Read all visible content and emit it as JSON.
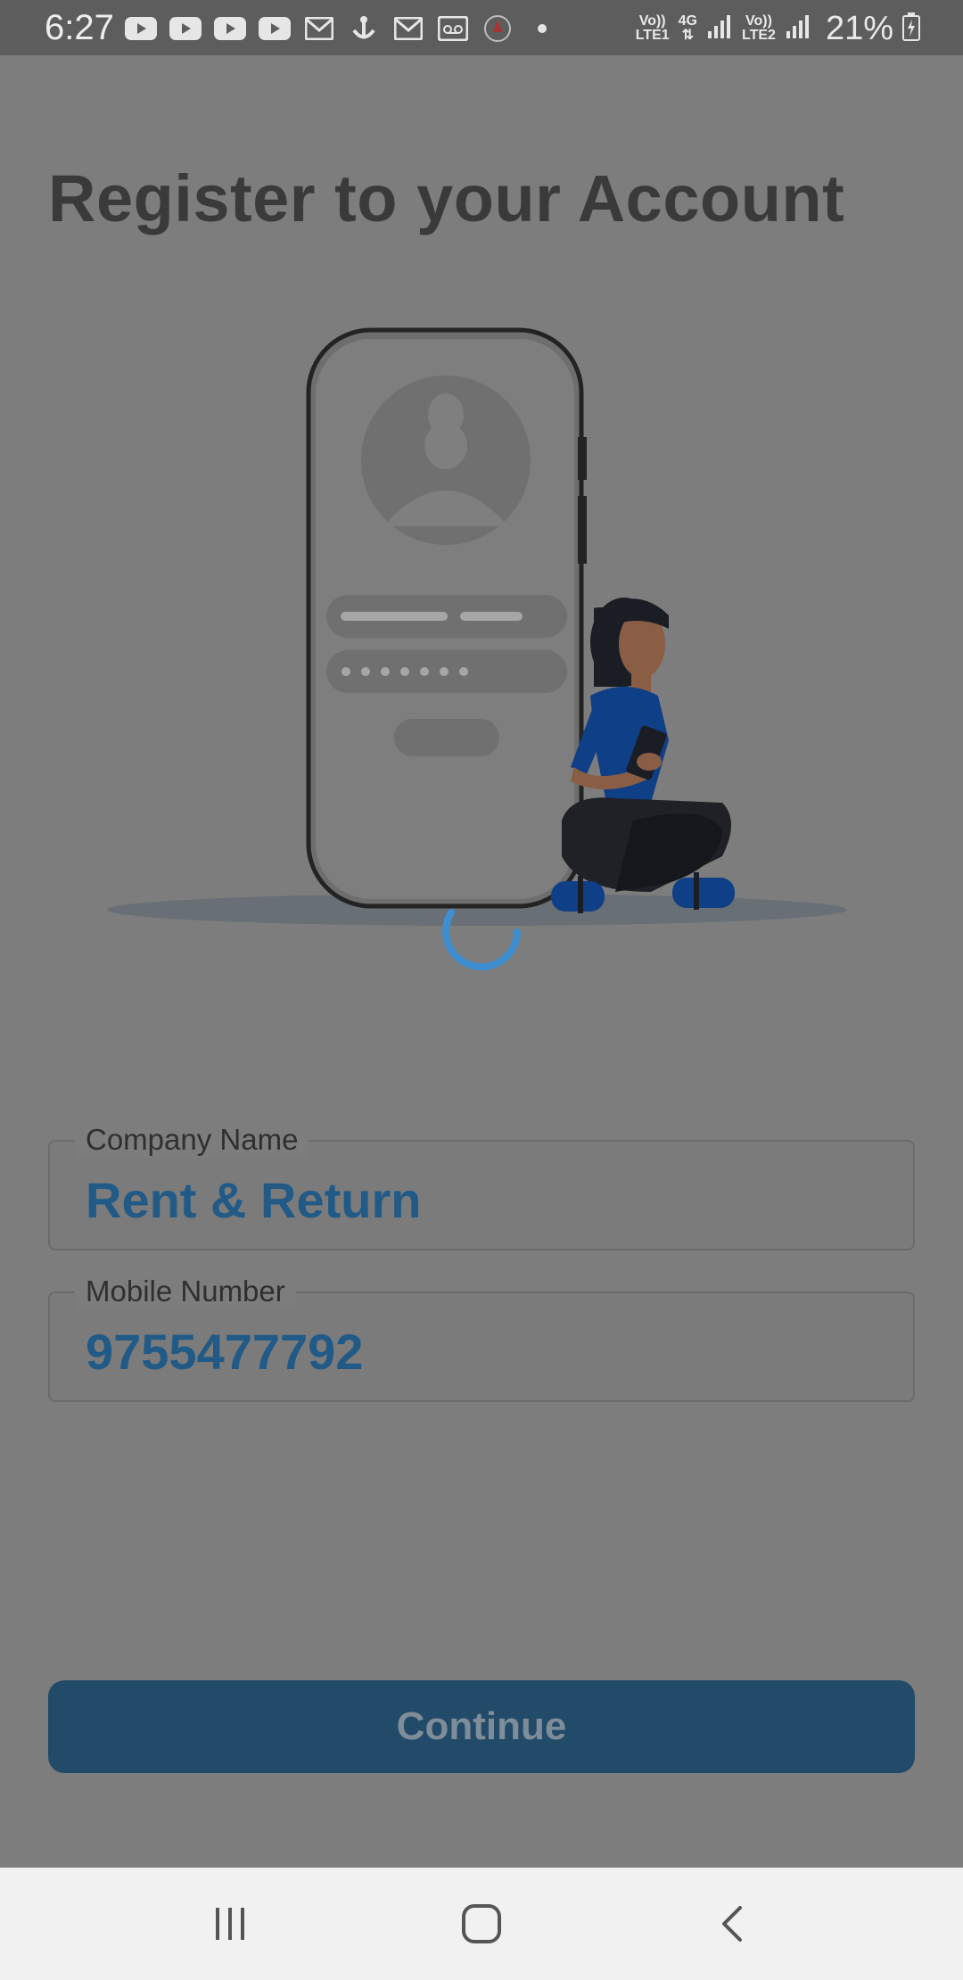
{
  "status_bar": {
    "time": "6:27",
    "notification_icons": [
      "youtube-icon",
      "youtube-icon",
      "youtube-icon",
      "youtube-icon",
      "gmail-icon",
      "anchor-icon",
      "gmail-icon",
      "voicemail-icon",
      "circle-app-icon",
      "dot-icon"
    ],
    "sim1_label_top": "Vo))",
    "sim1_label_bottom": "LTE1",
    "network_type": "4G",
    "sim2_label_top": "Vo))",
    "sim2_label_bottom": "LTE2",
    "battery": "21%"
  },
  "page": {
    "title": "Register to your Account"
  },
  "form": {
    "company_label": "Company Name",
    "company_value": "Rent & Return",
    "mobile_label": "Mobile Number",
    "mobile_value": "9755477792"
  },
  "actions": {
    "continue_label": "Continue"
  },
  "nav": {
    "recents": "recents-icon",
    "home": "home-icon",
    "back": "back-icon"
  },
  "colors": {
    "overlay": "#7d7d7d",
    "accent": "#215a86",
    "button": "#224a69",
    "spinner": "#3f8fd0"
  }
}
